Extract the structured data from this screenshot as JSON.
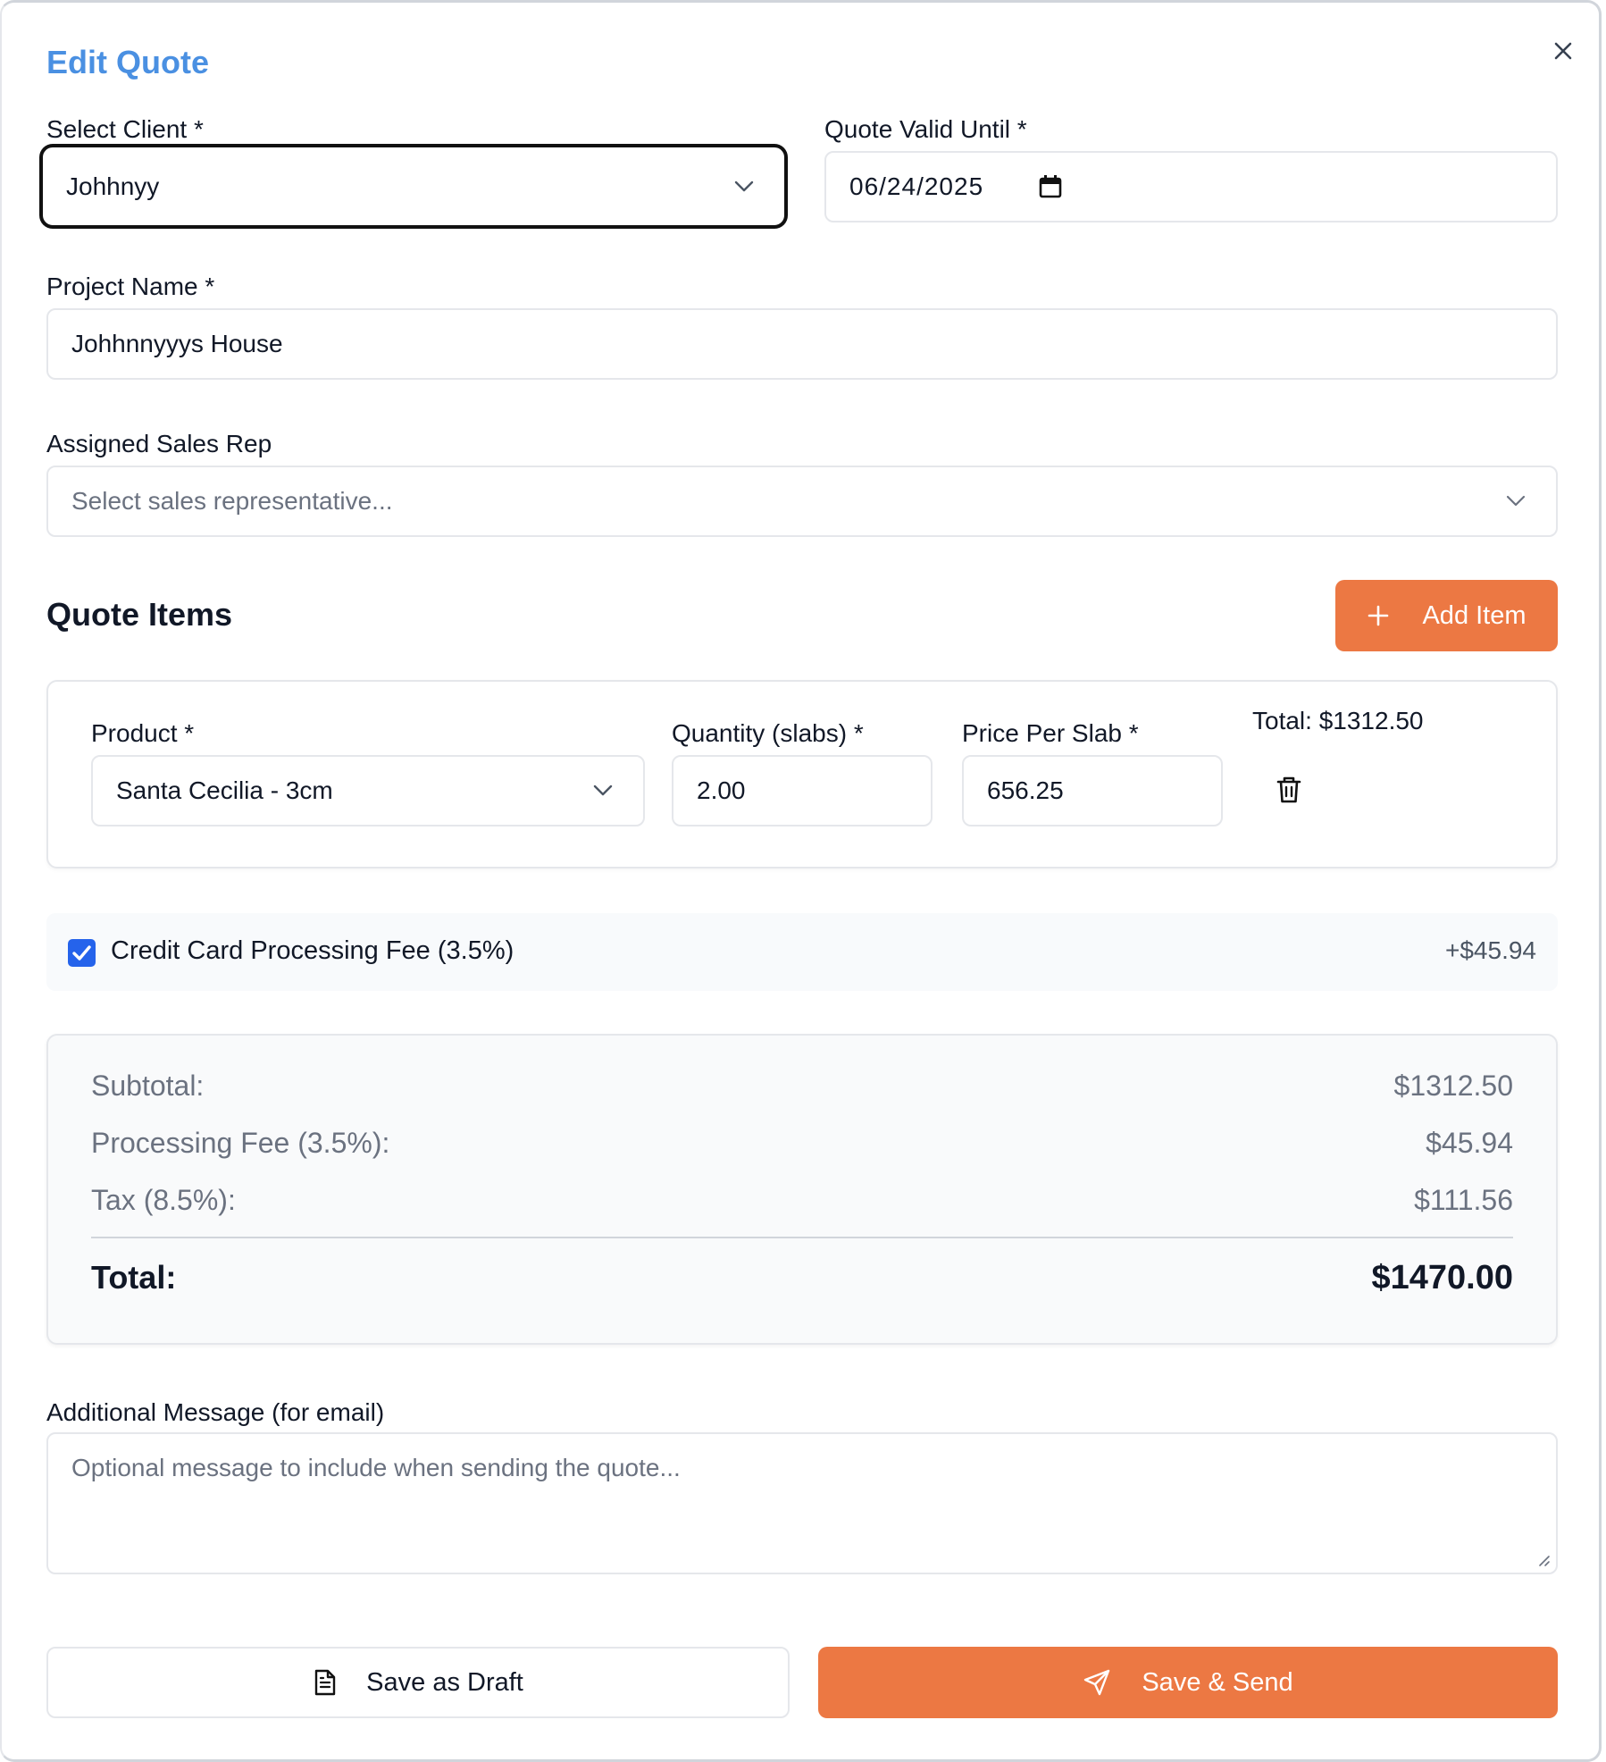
{
  "dialog": {
    "title": "Edit Quote"
  },
  "client": {
    "label": "Select Client *",
    "value": "Johhnyy"
  },
  "valid_until": {
    "label": "Quote Valid Until *",
    "value": "06/24/2025"
  },
  "project": {
    "label": "Project Name *",
    "value": "Johhnnyyys House"
  },
  "sales_rep": {
    "label": "Assigned Sales Rep",
    "placeholder": "Select sales representative..."
  },
  "quote_items": {
    "title": "Quote Items",
    "add_label": "Add Item",
    "item": {
      "product_label": "Product *",
      "product_value": "Santa Cecilia - 3cm",
      "quantity_label": "Quantity (slabs) *",
      "quantity_value": "2.00",
      "price_label": "Price Per Slab *",
      "price_value": "656.25",
      "total_text": "Total: $1312.50"
    }
  },
  "processing_fee": {
    "checked": true,
    "label": "Credit Card Processing Fee (3.5%)",
    "amount": "+$45.94"
  },
  "summary": {
    "subtotal_label": "Subtotal:",
    "subtotal_value": "$1312.50",
    "fee_label": "Processing Fee (3.5%):",
    "fee_value": "$45.94",
    "tax_label": "Tax (8.5%):",
    "tax_value": "$111.56",
    "total_label": "Total:",
    "total_value": "$1470.00"
  },
  "message": {
    "label": "Additional Message (for email)",
    "placeholder": "Optional message to include when sending the quote..."
  },
  "actions": {
    "draft_label": "Save as Draft",
    "send_label": "Save & Send"
  },
  "colors": {
    "accent": "#ec7843",
    "title": "#4a90e2",
    "checkbox": "#2563eb"
  }
}
